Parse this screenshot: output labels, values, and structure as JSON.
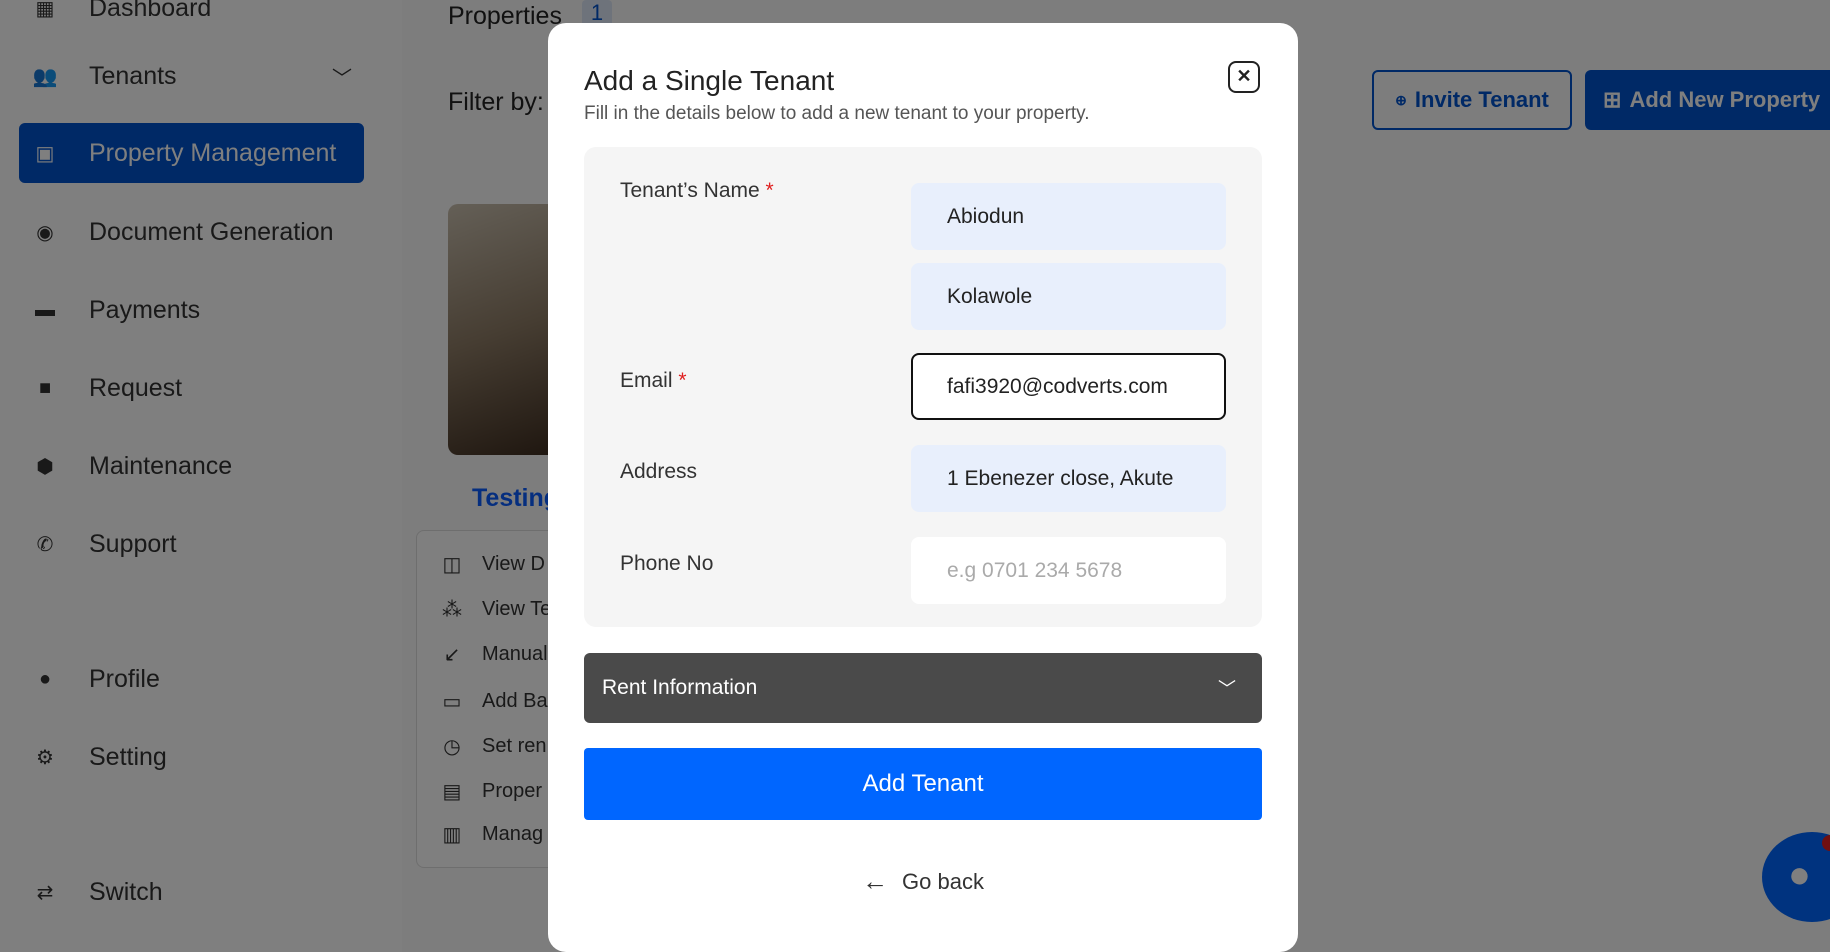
{
  "sidebar": {
    "items": [
      {
        "label": "Dashboard",
        "icon": "dashboard-icon"
      },
      {
        "label": "Tenants",
        "icon": "users-icon"
      },
      {
        "label": "Property Management",
        "icon": "building-icon",
        "active": true
      },
      {
        "label": "Document Generation",
        "icon": "document-icon"
      },
      {
        "label": "Payments",
        "icon": "card-icon"
      },
      {
        "label": "Request",
        "icon": "request-icon"
      },
      {
        "label": "Maintenance",
        "icon": "maintenance-icon"
      },
      {
        "label": "Support",
        "icon": "phone-icon"
      },
      {
        "label": "Profile",
        "icon": "user-icon"
      },
      {
        "label": "Setting",
        "icon": "gear-icon"
      },
      {
        "label": "Switch",
        "icon": "switch-icon"
      }
    ]
  },
  "main": {
    "properties_label": "Properties",
    "properties_count": "1",
    "filter_label": "Filter by:",
    "invite_button": "Invite Tenant",
    "add_property_button": "Add New Property",
    "card_title": "Testing",
    "card_menu": [
      "View D",
      "View Te",
      "Manual",
      "Add Ba",
      "Set ren",
      "Proper",
      "Manag"
    ]
  },
  "modal": {
    "title": "Add a Single Tenant",
    "subtitle": "Fill in the details below to add a new tenant to your property.",
    "name_label": "Tenant’s Name",
    "required_mark": "*",
    "first_name": "Abiodun",
    "last_name": "Kolawole",
    "email_label": "Email",
    "email": "fafi3920@codverts.com",
    "address_label": "Address",
    "address": "1 Ebenezer close, Akute",
    "phone_label": "Phone No",
    "phone_placeholder": "e.g 0701 234 5678",
    "rent_section": "Rent Information",
    "submit": "Add Tenant",
    "go_back": "Go back"
  },
  "colors": {
    "accent": "#0066ff",
    "sidebar_active": "#0052cc",
    "rent_bar": "#4a4a4a"
  }
}
